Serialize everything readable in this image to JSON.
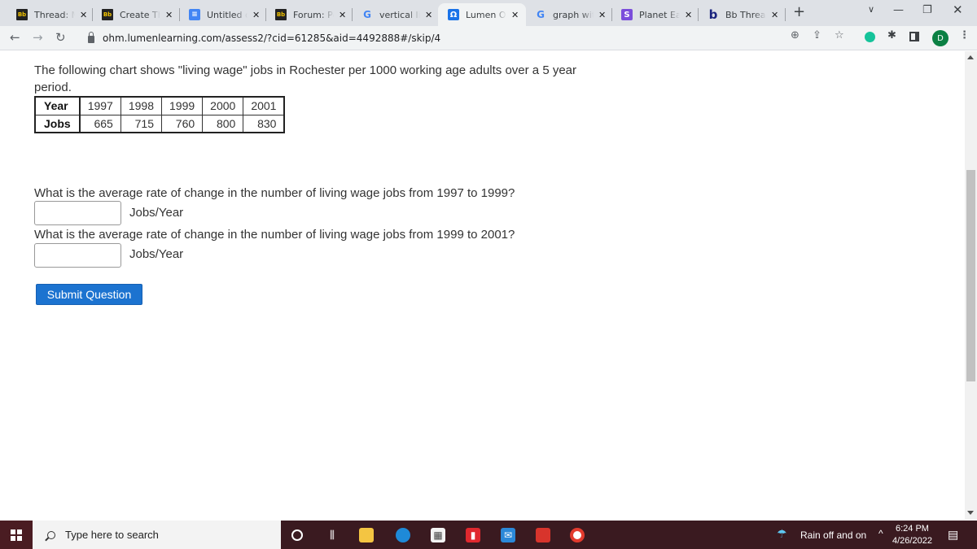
{
  "browser": {
    "tabs": [
      {
        "label": "Thread: My",
        "favicon": "blackboard-icon"
      },
      {
        "label": "Create Thr",
        "favicon": "blackboard-icon"
      },
      {
        "label": "Untitled do",
        "favicon": "google-docs-icon"
      },
      {
        "label": "Forum: Per",
        "favicon": "blackboard-icon"
      },
      {
        "label": "vertical line",
        "favicon": "google-icon"
      },
      {
        "label": "Lumen OH",
        "favicon": "lumen-omega-icon",
        "active": true
      },
      {
        "label": "graph with",
        "favicon": "google-icon"
      },
      {
        "label": "Planet Eart",
        "favicon": "planet-s-icon"
      },
      {
        "label": "Bb Thread:",
        "favicon": "bartleby-icon"
      }
    ],
    "new_tab": "+",
    "url": "ohm.lumenlearning.com/assess2/?cid=61285&aid=4492888#/skip/4",
    "profile_initial": "D"
  },
  "page": {
    "intro": "The following chart shows \"living wage\" jobs in Rochester per 1000 working age adults over a 5 year period.",
    "table": {
      "row_headers": [
        "Year",
        "Jobs"
      ],
      "years": [
        "1997",
        "1998",
        "1999",
        "2000",
        "2001"
      ],
      "jobs": [
        "665",
        "715",
        "760",
        "800",
        "830"
      ]
    },
    "questions": [
      {
        "text": "What is the average rate of change in the number of living wage jobs from 1997 to 1999?",
        "value": "",
        "unit": "Jobs/Year"
      },
      {
        "text": "What is the average rate of change in the number of living wage jobs from 1999 to 2001?",
        "value": "",
        "unit": "Jobs/Year"
      }
    ],
    "submit_label": "Submit Question"
  },
  "taskbar": {
    "search_placeholder": "Type here to search",
    "weather": "Rain off and on",
    "time": "6:24 PM",
    "date": "4/26/2022"
  }
}
